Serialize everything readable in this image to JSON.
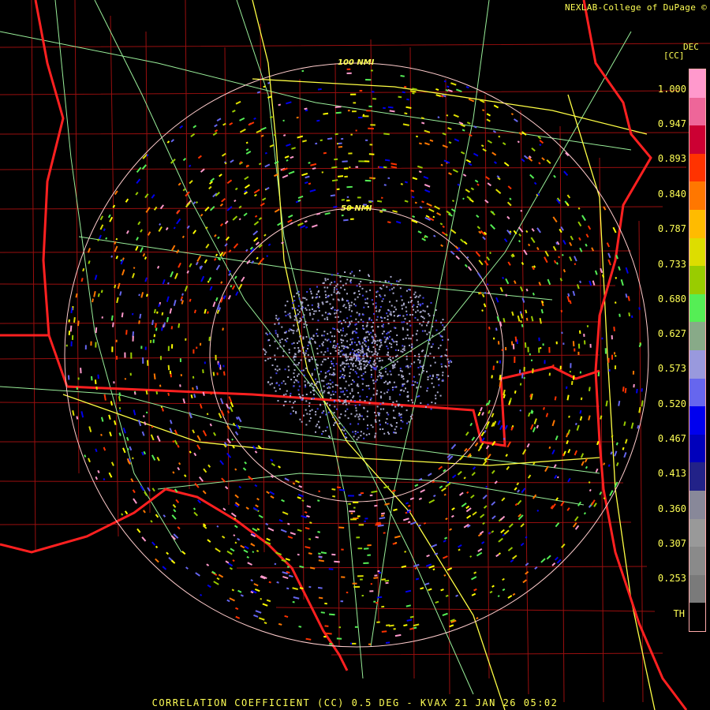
{
  "credit": "NEXLAB-College of DuPage ©",
  "legend": {
    "title_top": "DEC",
    "title_sub": "[CC]",
    "ticks": [
      "1.000",
      "0.947",
      "0.893",
      "0.840",
      "0.787",
      "0.733",
      "0.680",
      "0.627",
      "0.573",
      "0.520",
      "0.467",
      "0.413",
      "0.360",
      "0.307",
      "0.253",
      "TH"
    ],
    "color_bands": [
      "#ff99cc",
      "#ee6699",
      "#cc0033",
      "#ff3300",
      "#ff7700",
      "#ffbb00",
      "#dddd00",
      "#99cc00",
      "#55ee55",
      "#88aa88",
      "#9999dd",
      "#6666ee",
      "#0000ee",
      "#0000bb",
      "#222288",
      "#888899",
      "#999999",
      "#8a8a8a",
      "#7a7a7a",
      "#000000"
    ]
  },
  "rings": {
    "outer_label": "100 NMI",
    "inner_label": "50 NMI"
  },
  "footer": "CORRELATION COEFFICIENT (CC) 0.5 DEG - KVAX 21 JAN 26 05:02",
  "colors": {
    "state_lines": "#ff2020",
    "county_lines": "#aa1111",
    "highways": "#99ee99",
    "interstates": "#ffff44",
    "range_rings": "#ffcccc"
  }
}
